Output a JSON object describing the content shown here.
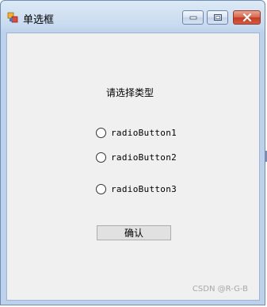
{
  "window": {
    "title": "单选框"
  },
  "icons": {
    "app": "app-form-icon",
    "minimize": "minimize-icon",
    "maximize": "maximize-icon",
    "close": "close-icon"
  },
  "form": {
    "prompt": "请选择类型",
    "radios": [
      {
        "label": "radioButton1",
        "checked": false
      },
      {
        "label": "radioButton2",
        "checked": false
      },
      {
        "label": "radioButton3",
        "checked": false
      }
    ],
    "confirm_label": "确认"
  },
  "watermark": "CSDN @R-G-B",
  "colors": {
    "client_bg": "#f0f0f0",
    "close_button": "#c43c23",
    "title_bar": "#c9dbef"
  }
}
